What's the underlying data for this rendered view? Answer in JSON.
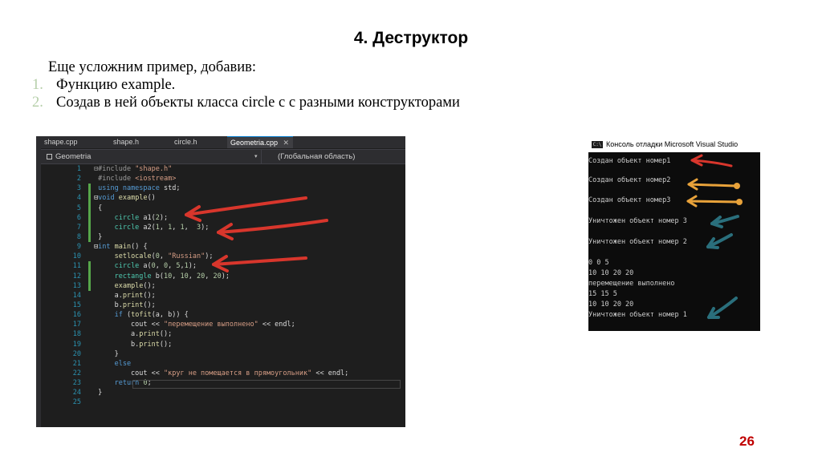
{
  "slide": {
    "title": "4. Деструктор",
    "intro": "Еще усложним пример, добавив:",
    "list": [
      {
        "num": "1.",
        "text": "Функцию example."
      },
      {
        "num": "2.",
        "text": "Создав в ней объекты класса circle с с разными конструкторами"
      }
    ],
    "page_number": "26"
  },
  "ide": {
    "tabs": [
      "shape.cpp",
      "shape.h",
      "circle.h",
      "Geometria.cpp"
    ],
    "active_tab": "Geometria.cpp",
    "close_glyph": "✕",
    "nav_project": "Geometria",
    "nav_scope": "(Глобальная область)",
    "dropdown_glyph": "▾",
    "line_numbers": [
      "1",
      "2",
      "3",
      "4",
      "5",
      "6",
      "7",
      "8",
      "9",
      "10",
      "11",
      "12",
      "13",
      "14",
      "15",
      "16",
      "17",
      "18",
      "19",
      "20",
      "21",
      "22",
      "23",
      "24",
      "25"
    ]
  },
  "console": {
    "title": "Консоль отладки Microsoft Visual Studio",
    "icon_text": "C:\\",
    "lines": [
      "Создан объект номер1",
      "Создан объект номер2",
      "Создан объект номер3",
      "Уничтожен объект номер 3",
      "Уничтожен объект номер 2",
      "0 0 5",
      "10 10 20 20",
      "перемещение выполнено",
      "15 15 5",
      "10 10 20 20",
      "Уничтожен объект номер 1"
    ]
  },
  "colors": {
    "red_arrow": "#d8362c",
    "orange_arrow": "#e8a23a",
    "teal_arrow": "#2a6f7c",
    "page_number": "#c00000",
    "ide_background": "#1e1e1e"
  }
}
